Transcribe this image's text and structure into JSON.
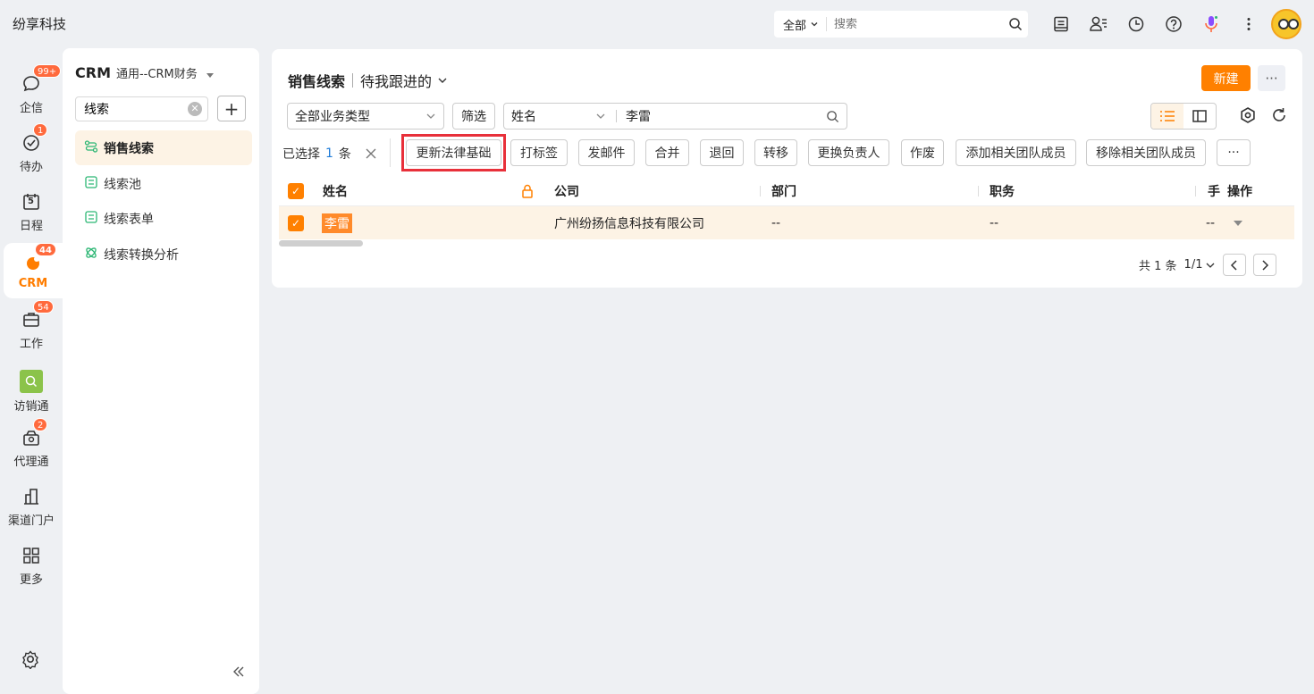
{
  "app_title": "纷享科技",
  "search": {
    "scope": "全部",
    "placeholder": "搜索"
  },
  "nav": [
    {
      "label": "企信",
      "icon": "chat-icon",
      "badge": "99+"
    },
    {
      "label": "待办",
      "icon": "check-circle-icon",
      "badge": "1"
    },
    {
      "label": "日程",
      "icon": "calendar-icon",
      "badge": "",
      "date": "5"
    },
    {
      "label": "CRM",
      "icon": "crm-icon",
      "badge": "44"
    },
    {
      "label": "工作",
      "icon": "briefcase-icon",
      "badge": "54"
    },
    {
      "label": "访销通",
      "icon": "visit-icon",
      "badge": ""
    },
    {
      "label": "代理通",
      "icon": "agent-icon",
      "badge": "2"
    },
    {
      "label": "渠道门户",
      "icon": "building-icon",
      "badge": ""
    },
    {
      "label": "更多",
      "icon": "grid-icon",
      "badge": ""
    }
  ],
  "sidebar": {
    "title_bold": "CRM",
    "title_sub": "通用--CRM财务",
    "search_value": "线索",
    "items": [
      {
        "label": "销售线索",
        "icon": "leads-icon"
      },
      {
        "label": "线索池",
        "icon": "pool-icon"
      },
      {
        "label": "线索表单",
        "icon": "form-icon"
      },
      {
        "label": "线索转换分析",
        "icon": "analysis-icon"
      }
    ]
  },
  "main": {
    "title": "销售线索",
    "view": "待我跟进的",
    "new_label": "新建",
    "more_label": "···",
    "type_select": "全部业务类型",
    "filter_label": "筛选",
    "field_select": "姓名",
    "field_value": "李雷",
    "selected": {
      "prefix": "已选择",
      "count": "1",
      "suffix": "条"
    },
    "actions": [
      "更新法律基础",
      "打标签",
      "发邮件",
      "合并",
      "退回",
      "转移",
      "更换负责人",
      "作废",
      "添加相关团队成员",
      "移除相关团队成员"
    ],
    "more_actions": "···"
  },
  "table": {
    "headers": [
      "姓名",
      "公司",
      "部门",
      "职务",
      "手",
      "操作"
    ],
    "rows": [
      {
        "name": "李雷",
        "company": "广州纷扬信息科技有限公司",
        "dept": "--",
        "title": "--",
        "phone": "--"
      }
    ]
  },
  "pager": {
    "total": "共 1 条",
    "page": "1/1"
  },
  "colors": {
    "accent": "#ff8000",
    "highlight": "#e8303a",
    "selected_row": "#fdf3e5"
  }
}
